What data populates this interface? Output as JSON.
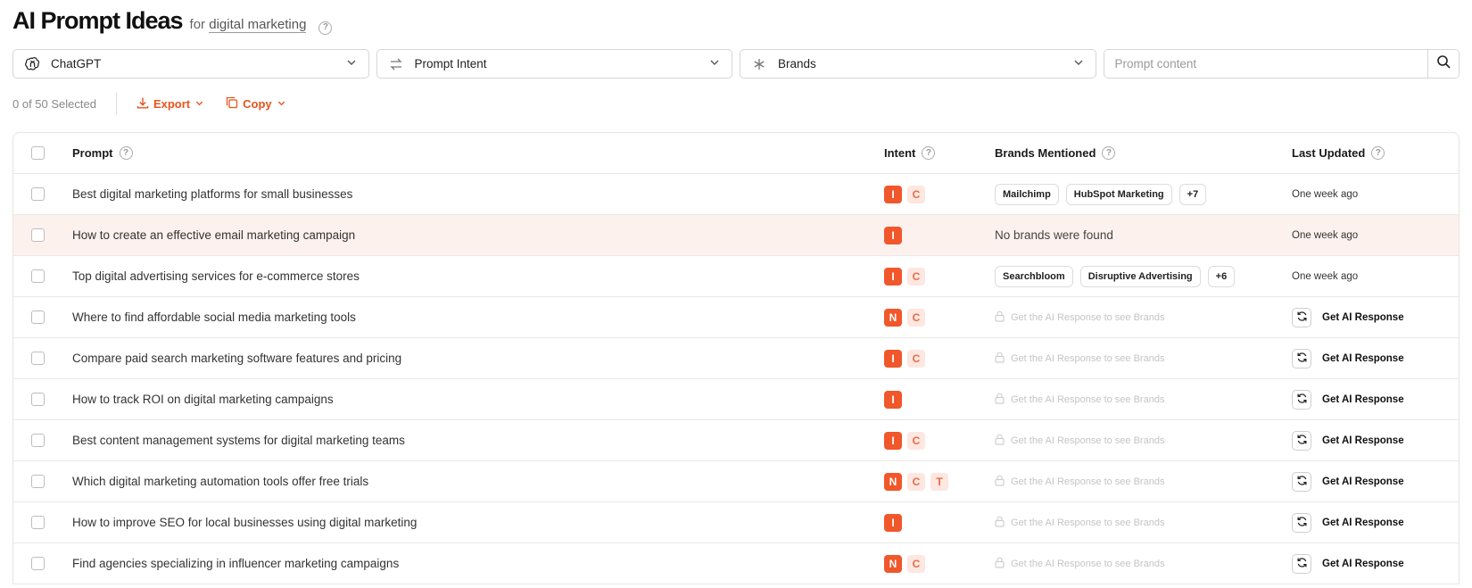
{
  "header": {
    "title": "AI Prompt Ideas",
    "for_label": "for",
    "topic": "digital marketing"
  },
  "filters": {
    "model": {
      "label": "ChatGPT",
      "icon": "openai-icon"
    },
    "intent": {
      "label": "Prompt Intent",
      "icon": "intent-arrows-icon"
    },
    "brands": {
      "label": "Brands",
      "icon": "asterisk-icon"
    },
    "search": {
      "placeholder": "Prompt content",
      "value": ""
    }
  },
  "toolbar": {
    "selected": "0 of 50 Selected",
    "export_label": "Export",
    "copy_label": "Copy"
  },
  "columns": {
    "prompt": "Prompt",
    "intent": "Intent",
    "brands": "Brands Mentioned",
    "updated": "Last Updated"
  },
  "colors": {
    "accent": "#f0572a",
    "accent_light": "#fde7e0",
    "highlight_row": "#fdf1ee"
  },
  "rows": [
    {
      "prompt": "Best digital marketing platforms for small businesses",
      "intents": [
        [
          "I",
          "solid"
        ],
        [
          "C",
          "light"
        ]
      ],
      "brands": [
        "Mailchimp",
        "HubSpot Marketing",
        "+7"
      ],
      "updated": "One week ago"
    },
    {
      "prompt": "How to create an effective email marketing campaign",
      "intents": [
        [
          "I",
          "solid"
        ]
      ],
      "brands_text": "No brands were found",
      "updated": "One week ago",
      "highlight": true
    },
    {
      "prompt": "Top digital advertising services for e-commerce stores",
      "intents": [
        [
          "I",
          "solid"
        ],
        [
          "C",
          "light"
        ]
      ],
      "brands": [
        "Searchbloom",
        "Disruptive Advertising",
        "+6"
      ],
      "updated": "One week ago"
    },
    {
      "prompt": "Where to find affordable social media marketing tools",
      "intents": [
        [
          "N",
          "solid"
        ],
        [
          "C",
          "light"
        ]
      ],
      "locked": "Get the AI Response to see Brands",
      "action": "Get AI Response"
    },
    {
      "prompt": "Compare paid search marketing software features and pricing",
      "intents": [
        [
          "I",
          "solid"
        ],
        [
          "C",
          "light"
        ]
      ],
      "locked": "Get the AI Response to see Brands",
      "action": "Get AI Response"
    },
    {
      "prompt": "How to track ROI on digital marketing campaigns",
      "intents": [
        [
          "I",
          "solid"
        ]
      ],
      "locked": "Get the AI Response to see Brands",
      "action": "Get AI Response"
    },
    {
      "prompt": "Best content management systems for digital marketing teams",
      "intents": [
        [
          "I",
          "solid"
        ],
        [
          "C",
          "light"
        ]
      ],
      "locked": "Get the AI Response to see Brands",
      "action": "Get AI Response"
    },
    {
      "prompt": "Which digital marketing automation tools offer free trials",
      "intents": [
        [
          "N",
          "solid"
        ],
        [
          "C",
          "light"
        ],
        [
          "T",
          "light"
        ]
      ],
      "locked": "Get the AI Response to see Brands",
      "action": "Get AI Response"
    },
    {
      "prompt": "How to improve SEO for local businesses using digital marketing",
      "intents": [
        [
          "I",
          "solid"
        ]
      ],
      "locked": "Get the AI Response to see Brands",
      "action": "Get AI Response"
    },
    {
      "prompt": "Find agencies specializing in influencer marketing campaigns",
      "intents": [
        [
          "N",
          "solid"
        ],
        [
          "C",
          "light"
        ]
      ],
      "locked": "Get the AI Response to see Brands",
      "action": "Get AI Response"
    }
  ]
}
